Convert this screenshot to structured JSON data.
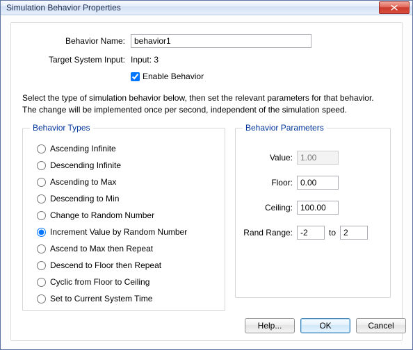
{
  "window": {
    "title": "Simulation Behavior Properties"
  },
  "form": {
    "behavior_name_label": "Behavior Name:",
    "behavior_name_value": "behavior1",
    "target_label": "Target System Input:",
    "target_value": "Input: 3",
    "enable_label": "Enable Behavior"
  },
  "description": {
    "line1": "Select the type of simulation behavior below, then set the relevant parameters for that behavior.",
    "line2": "The change will be implemented once per second, independent of the simulation speed."
  },
  "types": {
    "legend": "Behavior Types",
    "options": [
      "Ascending Infinite",
      "Descending Infinite",
      "Ascending to Max",
      "Descending to Min",
      "Change to Random Number",
      "Increment Value by Random Number",
      "Ascend to Max then Repeat",
      "Descend to Floor then Repeat",
      "Cyclic from Floor to Ceiling",
      "Set to Current System Time"
    ],
    "selected_index": 5
  },
  "params": {
    "legend": "Behavior Parameters",
    "value_label": "Value:",
    "value_value": "1.00",
    "floor_label": "Floor:",
    "floor_value": "0.00",
    "ceiling_label": "Ceiling:",
    "ceiling_value": "100.00",
    "rand_label": "Rand Range:",
    "rand_from": "-2",
    "rand_to_label": "to",
    "rand_to": "2"
  },
  "buttons": {
    "help": "Help...",
    "ok": "OK",
    "cancel": "Cancel"
  }
}
